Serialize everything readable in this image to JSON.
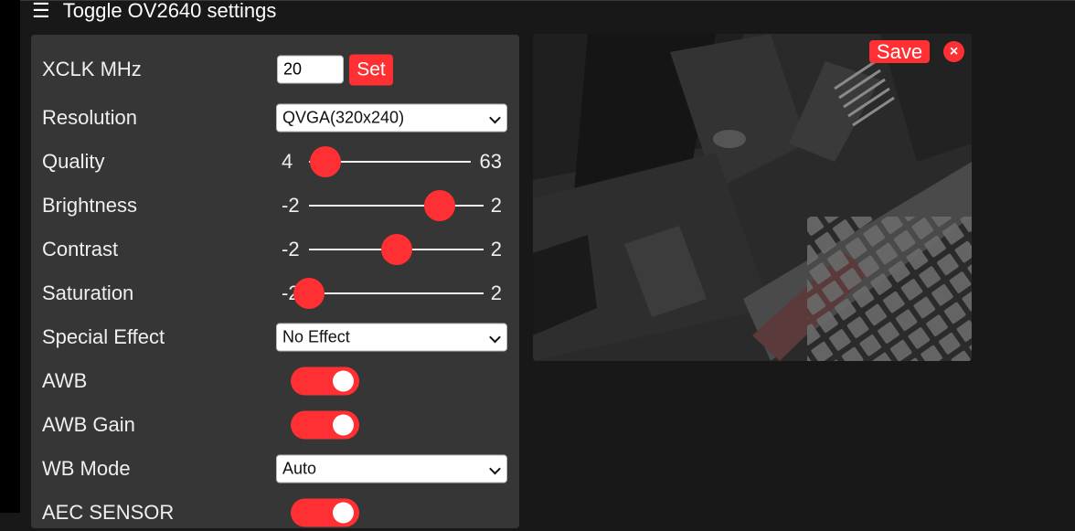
{
  "nav": {
    "icon": "menu-icon",
    "toggle_label": "Toggle OV2640 settings"
  },
  "settings": {
    "xclk": {
      "label": "XCLK MHz",
      "value": "20",
      "set_label": "Set"
    },
    "resolution": {
      "label": "Resolution",
      "value": "QVGA(320x240)"
    },
    "quality": {
      "label": "Quality",
      "min": "4",
      "max": "63",
      "value": 10
    },
    "brightness": {
      "label": "Brightness",
      "min": "-2",
      "max": "2",
      "value": 1
    },
    "contrast": {
      "label": "Contrast",
      "min": "-2",
      "max": "2",
      "value": 0
    },
    "saturation": {
      "label": "Saturation",
      "min": "-2",
      "max": "2",
      "value": -2
    },
    "special_effect": {
      "label": "Special Effect",
      "value": "No Effect"
    },
    "awb": {
      "label": "AWB",
      "on": true
    },
    "awb_gain": {
      "label": "AWB Gain",
      "on": true
    },
    "wb_mode": {
      "label": "WB Mode",
      "value": "Auto"
    },
    "aec_sensor": {
      "label": "AEC SENSOR",
      "on": true
    }
  },
  "stream": {
    "save_label": "Save",
    "close_glyph": "×",
    "image": "camera-stream-frame"
  },
  "colors": {
    "accent": "#ff3034",
    "panel": "#363636",
    "background": "#181818"
  }
}
